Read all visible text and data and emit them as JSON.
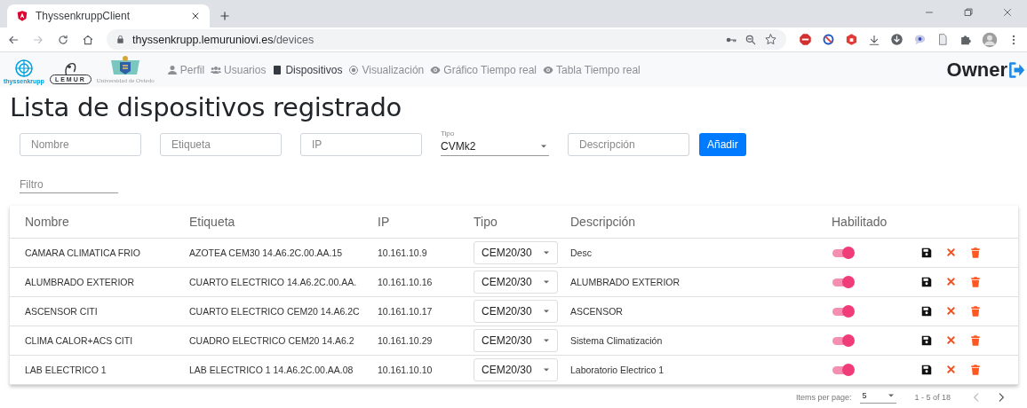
{
  "browser": {
    "tab_title": "ThyssenkruppClient",
    "url_host": "thyssenkrupp.lemuruniovi.es",
    "url_path": "/devices"
  },
  "nav": {
    "logos": [
      {
        "kind": "thyssenkrupp",
        "label": "thyssenkrupp"
      },
      {
        "kind": "lemur",
        "label": "LEMUR"
      },
      {
        "kind": "uniovi",
        "label": "Universidad de Oviedo"
      }
    ],
    "items": [
      {
        "label": "Perfil",
        "kind": "person",
        "selected": false
      },
      {
        "label": "Usuarios",
        "kind": "users",
        "selected": false
      },
      {
        "label": "Dispositivos",
        "kind": "tablet",
        "selected": true
      },
      {
        "label": "Visualización",
        "kind": "radio",
        "selected": false
      },
      {
        "label": "Gráfico Tiempo real",
        "kind": "eye",
        "selected": false
      },
      {
        "label": "Tabla Tiempo real",
        "kind": "eye",
        "selected": false
      }
    ],
    "user": "Owner"
  },
  "heading": "Lista de dispositivos registrado",
  "form": {
    "fields": [
      {
        "kind": "input",
        "placeholder": "Nombre"
      },
      {
        "kind": "input",
        "placeholder": "Etiqueta"
      },
      {
        "kind": "input",
        "placeholder": "IP"
      },
      {
        "kind": "select",
        "label": "Tipo",
        "value": "CVMk2"
      },
      {
        "kind": "input",
        "placeholder": "Descripción"
      }
    ],
    "add_button": "Añadir"
  },
  "filter": {
    "placeholder": "Filtro"
  },
  "table": {
    "columns": [
      "Nombre",
      "Etiqueta",
      "IP",
      "Tipo",
      "Descripción",
      "Habilitado"
    ],
    "rows": [
      {
        "nombre": "CAMARA CLIMATICA FRIO",
        "etiqueta": "AZOTEA CEM30 14.A6.2C.00.AA.15",
        "ip": "10.161.10.9",
        "tipo": "CEM20/30",
        "descripcion": "Desc",
        "enabled": true
      },
      {
        "nombre": "ALUMBRADO EXTERIOR",
        "etiqueta": "CUARTO ELECTRICO 14.A6.2C.00.AA.",
        "ip": "10.161.10.16",
        "tipo": "CEM20/30",
        "descripcion": "ALUMBRADO EXTERIOR",
        "enabled": true
      },
      {
        "nombre": "ASCENSOR CITI",
        "etiqueta": "CUARTO ELECTRICO CEM20 14.A6.2C",
        "ip": "10.161.10.17",
        "tipo": "CEM20/30",
        "descripcion": "ASCENSOR",
        "enabled": true
      },
      {
        "nombre": "CLIMA CALOR+ACS CITI",
        "etiqueta": "CUADRO ELECTRICO CEM20 14.A6.2",
        "ip": "10.161.10.29",
        "tipo": "CEM20/30",
        "descripcion": "Sistema Climatización",
        "enabled": true
      },
      {
        "nombre": "LAB ELECTRICO 1",
        "etiqueta": "LAB ELECTRICO 1 14.A6.2C.00.AA.08",
        "ip": "10.161.10.10",
        "tipo": "CEM20/30",
        "descripcion": "Laboratorio Electrico 1",
        "enabled": true
      }
    ]
  },
  "paginator": {
    "label": "Items per page:",
    "page_size": "5",
    "range": "1 - 5 of 18"
  }
}
